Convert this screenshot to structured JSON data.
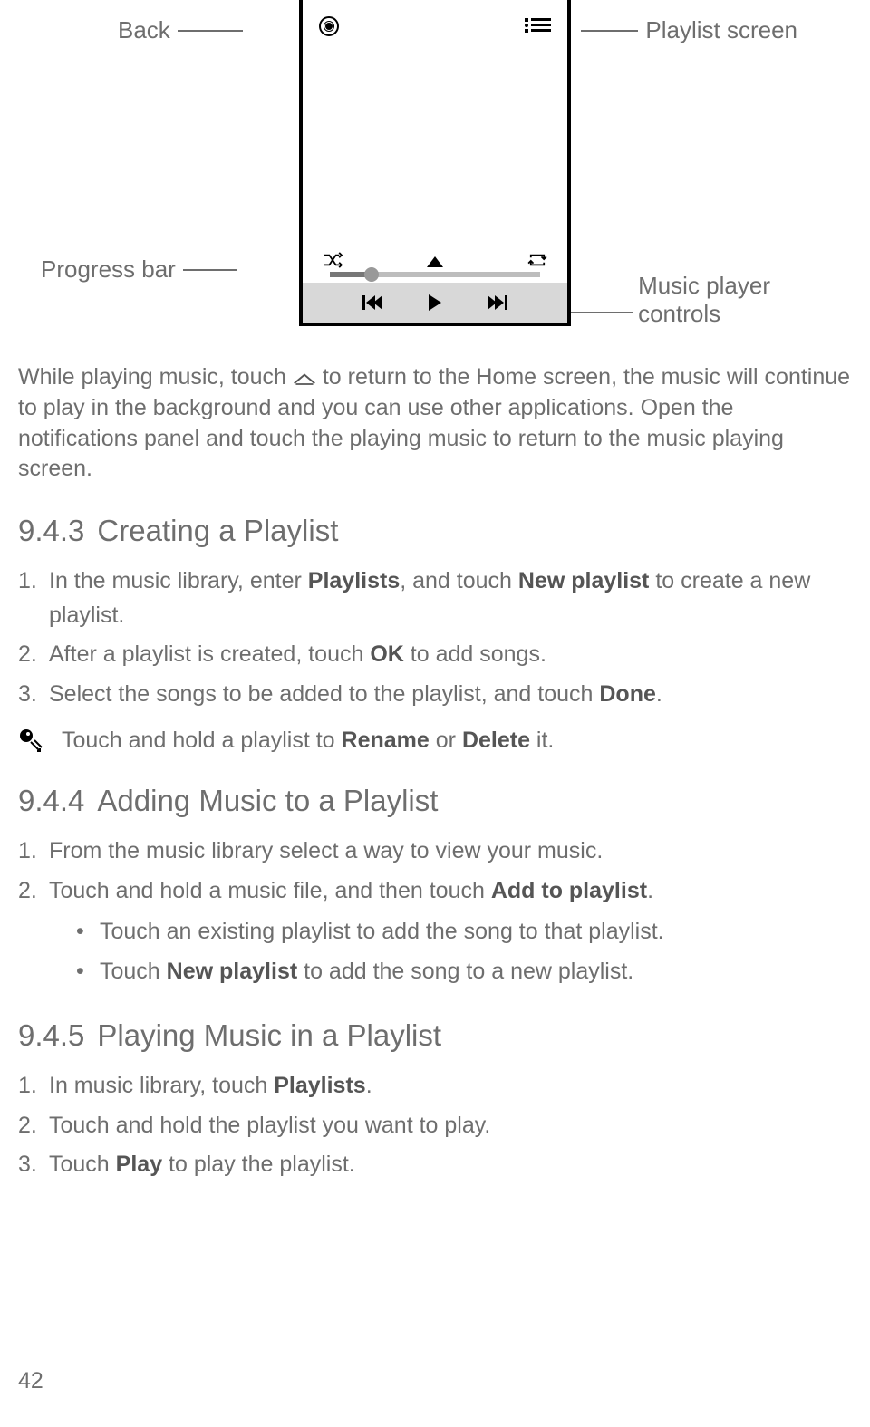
{
  "diagram": {
    "labels": {
      "back": "Back",
      "playlist_screen": "Playlist screen",
      "progress_bar": "Progress bar",
      "music_controls_l1": "Music player",
      "music_controls_l2": "controls"
    }
  },
  "para1_pre": "While playing music, touch ",
  "para1_post": " to return to the Home screen, the music will continue to play in the background and you can use other applications. Open the notifications panel and touch the playing music to return to the music playing screen.",
  "sec943": {
    "num": "9.4.3",
    "title": "Creating a Playlist"
  },
  "list943": {
    "i1_a": "In the music library, enter ",
    "i1_b": "Playlists",
    "i1_c": ", and touch ",
    "i1_d": "New playlist",
    "i1_e": " to create a new playlist.",
    "i2_a": "After a playlist is created, touch ",
    "i2_b": "OK",
    "i2_c": " to add songs.",
    "i3_a": "Select the songs to be added to the playlist, and touch ",
    "i3_b": "Done",
    "i3_c": "."
  },
  "tip943": {
    "a": "Touch and hold a playlist to ",
    "b": "Rename",
    "c": " or ",
    "d": "Delete",
    "e": " it."
  },
  "sec944": {
    "num": "9.4.4",
    "title": "Adding Music to a Playlist"
  },
  "list944": {
    "i1": "From the music library select a way to view your music.",
    "i2_a": "Touch and hold a music file, and then touch ",
    "i2_b": "Add to playlist",
    "i2_c": ".",
    "b1": "Touch an existing playlist to add the song to that playlist.",
    "b2_a": "Touch ",
    "b2_b": "New playlist",
    "b2_c": " to add the song to a new playlist."
  },
  "sec945": {
    "num": "9.4.5",
    "title": "Playing Music in a Playlist"
  },
  "list945": {
    "i1_a": "In music library, touch ",
    "i1_b": "Playlists",
    "i1_c": ".",
    "i2": "Touch and hold the playlist you want to play.",
    "i3_a": "Touch ",
    "i3_b": "Play",
    "i3_c": " to play the playlist."
  },
  "page_number": "42"
}
